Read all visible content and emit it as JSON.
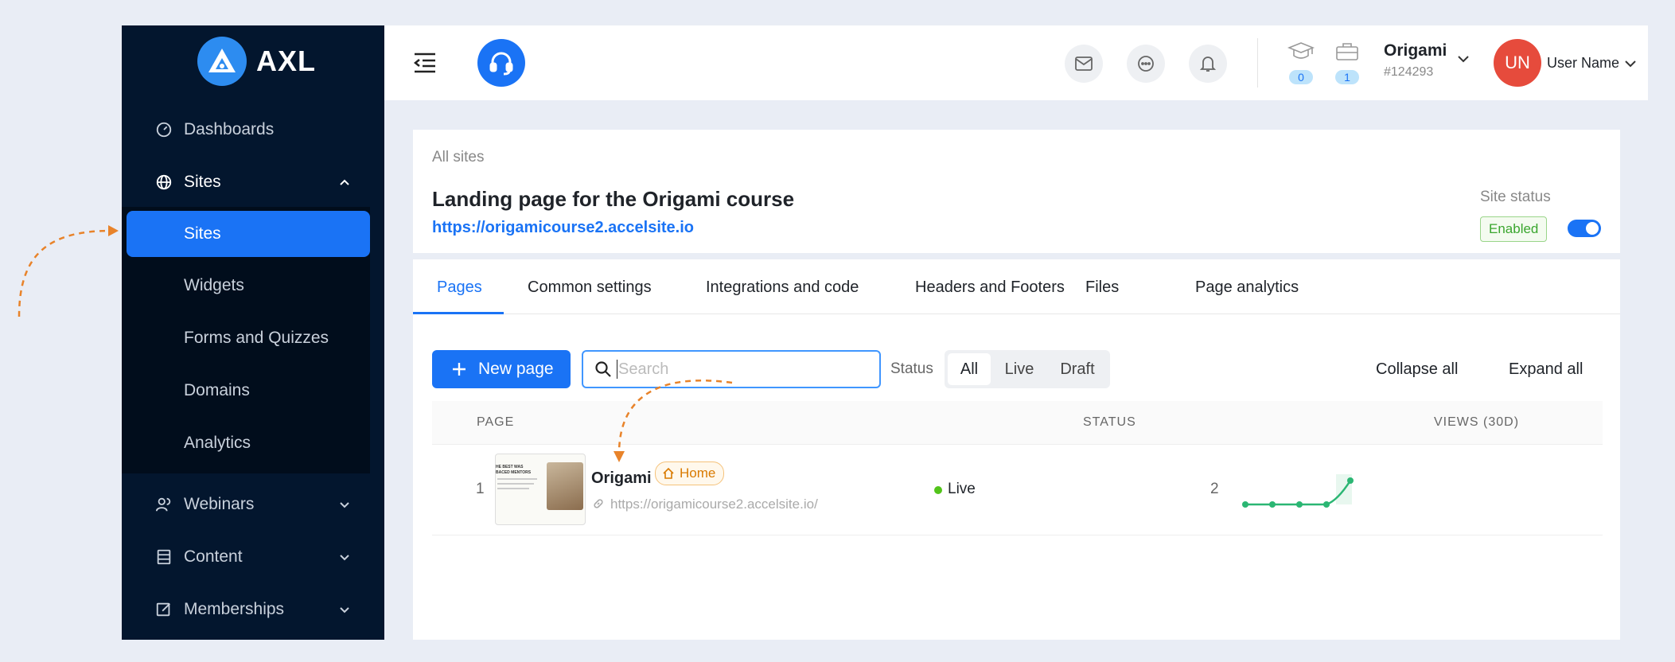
{
  "brand": {
    "name": "AXL"
  },
  "sidebar": {
    "items": [
      {
        "label": "Dashboards"
      },
      {
        "label": "Sites"
      },
      {
        "label": "Webinars"
      },
      {
        "label": "Content"
      },
      {
        "label": "Memberships"
      }
    ],
    "submenu": [
      {
        "label": "Sites",
        "active": true
      },
      {
        "label": "Widgets"
      },
      {
        "label": "Forms and Quizzes"
      },
      {
        "label": "Domains"
      },
      {
        "label": "Analytics"
      }
    ]
  },
  "header": {
    "courses_count": "0",
    "products_count": "1",
    "account_name": "Origami",
    "account_id": "#124293",
    "avatar_initials": "UN",
    "user_name": "User Name"
  },
  "site": {
    "breadcrumb": "All sites",
    "title": "Landing page for the Origami course",
    "url": "https://origamicourse2.accelsite.io",
    "status_label": "Site status",
    "status_value": "Enabled"
  },
  "tabs": [
    {
      "label": "Pages"
    },
    {
      "label": "Common settings"
    },
    {
      "label": "Integrations and code"
    },
    {
      "label": "Headers and Footers"
    },
    {
      "label": "Files"
    },
    {
      "label": "Page analytics"
    }
  ],
  "toolbar": {
    "new_page": "New page",
    "search_placeholder": "Search",
    "status_label": "Status",
    "filters": [
      "All",
      "Live",
      "Draft"
    ],
    "collapse_all": "Collapse all",
    "expand_all": "Expand all"
  },
  "table": {
    "columns": [
      "PAGE",
      "STATUS",
      "VIEWS (30D)"
    ],
    "rows": [
      {
        "index": "1",
        "name": "Origami",
        "tag": "Home",
        "url": "https://origamicourse2.accelsite.io/",
        "status": "Live",
        "views": "2",
        "thumb_text": "HE BEST WAS\nBACED MENTORS"
      }
    ]
  },
  "colors": {
    "accent": "#1a73f5",
    "sidebar_bg": "#03162e",
    "live": "#52c41a",
    "sparkline": "#2bb673",
    "annotation": "#e8832a"
  }
}
